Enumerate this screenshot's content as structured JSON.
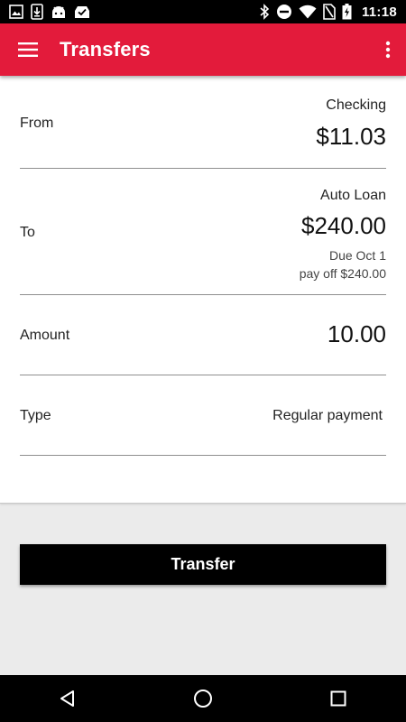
{
  "status_bar": {
    "time": "11:18",
    "left_icons": [
      "photo-icon",
      "download-icon",
      "android-icon",
      "inbox-check-icon"
    ],
    "right_icons": [
      "bluetooth-icon",
      "do-not-disturb-icon",
      "wifi-icon",
      "battery-charging-icon"
    ]
  },
  "app_bar": {
    "title": "Transfers",
    "background": "#e31b3b",
    "menu_icon": "hamburger-menu-icon",
    "overflow_icon": "more-vert-icon"
  },
  "form": {
    "from": {
      "label": "From",
      "account": "Checking",
      "balance": "$11.03"
    },
    "to": {
      "label": "To",
      "account": "Auto Loan",
      "balance": "$240.00",
      "due": "Due Oct 1",
      "payoff": "pay off $240.00"
    },
    "amount": {
      "label": "Amount",
      "value": "10.00"
    },
    "type": {
      "label": "Type",
      "value": "Regular payment"
    }
  },
  "transfer_button": {
    "label": "Transfer"
  },
  "nav_bar": {
    "icons": [
      "back-icon",
      "home-icon",
      "recents-icon"
    ]
  }
}
